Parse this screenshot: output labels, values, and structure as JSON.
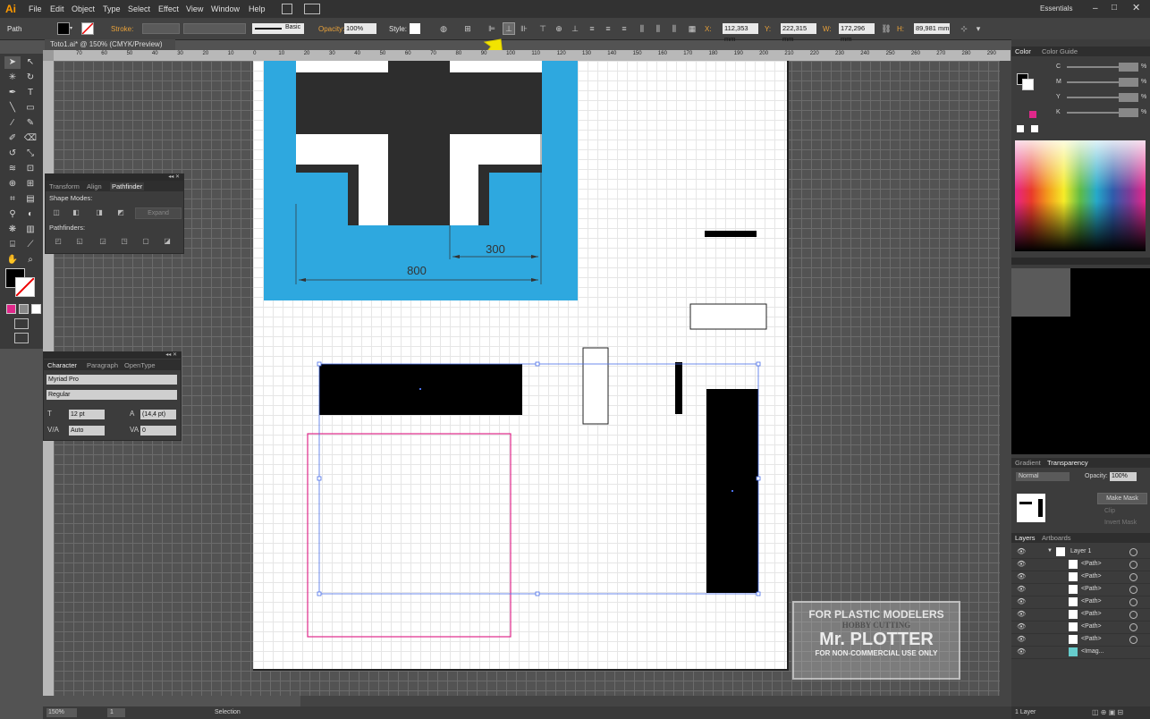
{
  "app": {
    "logo": "Ai",
    "workspace": "Essentials"
  },
  "menu": [
    "File",
    "Edit",
    "Object",
    "Type",
    "Select",
    "Effect",
    "View",
    "Window",
    "Help"
  ],
  "control": {
    "selection_label": "Path",
    "stroke_label": "Stroke:",
    "brush_label": "Basic",
    "opacity_label": "Opacity:",
    "opacity_value": "100%",
    "style_label": "Style:",
    "x_label": "X:",
    "x_value": "112,353 mm",
    "y_label": "Y:",
    "y_value": "222,315 mm",
    "w_label": "W:",
    "w_value": "172,296 mm",
    "h_label": "H:",
    "h_value": "89,981 mm"
  },
  "document": {
    "tab": "Toto1.ai* @ 150% (CMYK/Preview)"
  },
  "ruler": {
    "h_ticks": [
      "70",
      "60",
      "50",
      "40",
      "30",
      "20",
      "10",
      "0",
      "10",
      "20",
      "30",
      "40",
      "50",
      "60",
      "70",
      "80",
      "90",
      "100",
      "110",
      "120",
      "130",
      "140",
      "150",
      "160",
      "170",
      "180",
      "190",
      "200",
      "210",
      "220",
      "230",
      "240",
      "250",
      "260",
      "270",
      "280",
      "290"
    ]
  },
  "pathfinder": {
    "tabs": [
      "Transform",
      "Align",
      "Pathfinder"
    ],
    "shape_modes": "Shape Modes:",
    "expand": "Expand",
    "pathfinders": "Pathfinders:"
  },
  "character": {
    "tabs": [
      "Character",
      "Paragraph",
      "OpenType"
    ],
    "font": "Myriad Pro",
    "style": "Regular",
    "size": "12 pt",
    "leading": "(14,4 pt)",
    "kerning": "Auto",
    "tracking": "0"
  },
  "drawing": {
    "dim1": "800",
    "dim2": "300"
  },
  "color_panel": {
    "tabs": [
      "Color",
      "Color Guide"
    ],
    "channels": [
      "C",
      "M",
      "Y",
      "K"
    ],
    "unit": "%"
  },
  "transparency": {
    "tabs": [
      "Gradient",
      "Transparency"
    ],
    "blend": "Normal",
    "opacity_label": "Opacity:",
    "opacity_value": "100%",
    "make_mask": "Make Mask",
    "clip": "Clip",
    "invert": "Invert Mask"
  },
  "layers": {
    "tabs": [
      "Layers",
      "Artboards"
    ],
    "rows": [
      "Layer 1",
      "<Path>",
      "<Path>",
      "<Path>",
      "<Path>",
      "<Path>",
      "<Path>",
      "<Path>",
      "<Imag..."
    ],
    "count": "1 Layer"
  },
  "status": {
    "zoom": "150%",
    "page": "1",
    "tool": "Selection"
  },
  "watermark": {
    "line1": "FOR PLASTIC MODELERS",
    "line2": "HOBBY CUTTING",
    "line3": "Mr. PLOTTER",
    "line4": "FOR NON-COMMERCIAL USE ONLY"
  },
  "colors": {
    "accent_blue": "#2ea8df",
    "magenta": "#e0288a",
    "arrow": "#f2e400",
    "ui_dark": "#323232"
  }
}
